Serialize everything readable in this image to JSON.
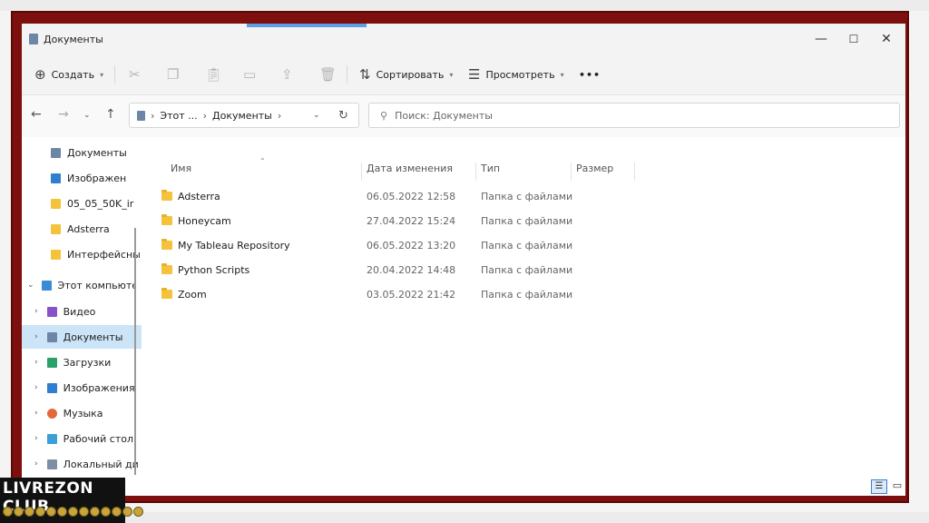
{
  "window": {
    "title": "Документы",
    "minimize": "—",
    "maximize": "☐",
    "close": "✕"
  },
  "toolbar": {
    "create_label": "Создать",
    "sort_label": "Сортировать",
    "view_label": "Просмотреть",
    "more_label": "•••"
  },
  "address": {
    "segments": [
      "Этот ...",
      "Документы"
    ],
    "search_placeholder": "Поиск: Документы"
  },
  "sidebar": {
    "quick": [
      {
        "label": "Документы",
        "pinned": true
      },
      {
        "label": "Изображен",
        "pinned": true
      },
      {
        "label": "05_05_50K_ir",
        "pinned": true
      },
      {
        "label": "Adsterra",
        "pinned": false
      },
      {
        "label": "Интерфейсны",
        "pinned": false
      }
    ],
    "pc_label": "Этот компьютер",
    "pc_items": [
      {
        "label": "Видео"
      },
      {
        "label": "Документы"
      },
      {
        "label": "Загрузки"
      },
      {
        "label": "Изображения"
      },
      {
        "label": "Музыка"
      },
      {
        "label": "Рабочий стол"
      },
      {
        "label": "Локальный ди"
      }
    ]
  },
  "columns": {
    "name": "Имя",
    "date": "Дата изменения",
    "type": "Тип",
    "size": "Размер"
  },
  "files": [
    {
      "name": "Adsterra",
      "date": "06.05.2022 12:58",
      "type": "Папка с файлами"
    },
    {
      "name": "Honeycam",
      "date": "27.04.2022 15:24",
      "type": "Папка с файлами"
    },
    {
      "name": "My Tableau Repository",
      "date": "06.05.2022 13:20",
      "type": "Папка с файлами"
    },
    {
      "name": "Python Scripts",
      "date": "20.04.2022 14:48",
      "type": "Папка с файлами"
    },
    {
      "name": "Zoom",
      "date": "03.05.2022 21:42",
      "type": "Папка с файлами"
    }
  ],
  "overlay": {
    "logo_text": "LIVREZON CLUB"
  },
  "colors": {
    "frame": "#7d0f0f",
    "selection": "#cce4f7",
    "folder": "#f5c33b",
    "accent": "#5d9fe3"
  }
}
